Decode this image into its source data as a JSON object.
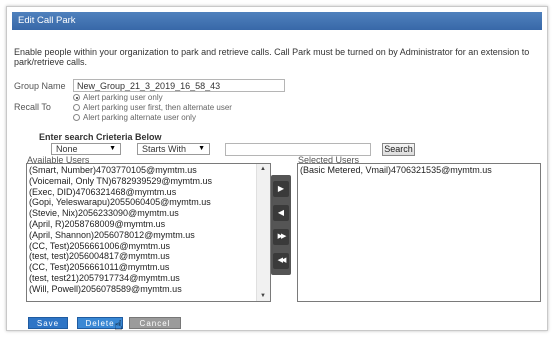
{
  "dialog": {
    "title": "Edit Call Park"
  },
  "intro": "Enable people within your organization to park and retrieve calls. Call Park must be turned on by Administrator for an extension to park/retrieve calls.",
  "group": {
    "label": "Group Name",
    "value": "New_Group_21_3_2019_16_58_43"
  },
  "recall": {
    "label": "Recall To",
    "options": [
      {
        "label": "Alert parking user only",
        "checked": true
      },
      {
        "label": "Alert parking user first, then alternate user",
        "checked": false
      },
      {
        "label": "Alert parking alternate user only",
        "checked": false
      }
    ]
  },
  "search": {
    "header": "Enter search Crieteria Below",
    "field_select": "None",
    "match_select": "Starts With",
    "query": "",
    "button": "Search"
  },
  "available": {
    "label": "Available Users",
    "items": [
      "(Smart, Number)4703770105@mymtm.us",
      "(Voicemail, Only TN)6782939529@mymtm.us",
      "(Exec, DID)4706321468@mymtm.us",
      "(Gopi, Yeleswarapu)2055060405@mymtm.us",
      "(Stevie, Nix)2056233090@mymtm.us",
      "(April, R)2058768009@mymtm.us",
      "(April, Shannon)2056078012@mymtm.us",
      "(CC, Test)2056661006@mymtm.us",
      "(test, test)2056004817@mymtm.us",
      "(CC, Test)2056661011@mymtm.us",
      "(test, test21)2057917734@mymtm.us",
      "(Will, Powell)2056078589@mymtm.us"
    ]
  },
  "selected": {
    "label": "Selected Users",
    "items": [
      "(Basic Metered, Vmail)4706321535@mymtm.us"
    ]
  },
  "move_buttons": [
    "move-right",
    "move-left",
    "move-all-right",
    "move-all-left"
  ],
  "footer": {
    "save": "Save",
    "delete": "Delete",
    "cancel": "Cancel"
  },
  "colors": {
    "title_bar": "#4f81bd",
    "primary_button": "#2e75c6",
    "disabled_button": "#9b9b9b"
  }
}
